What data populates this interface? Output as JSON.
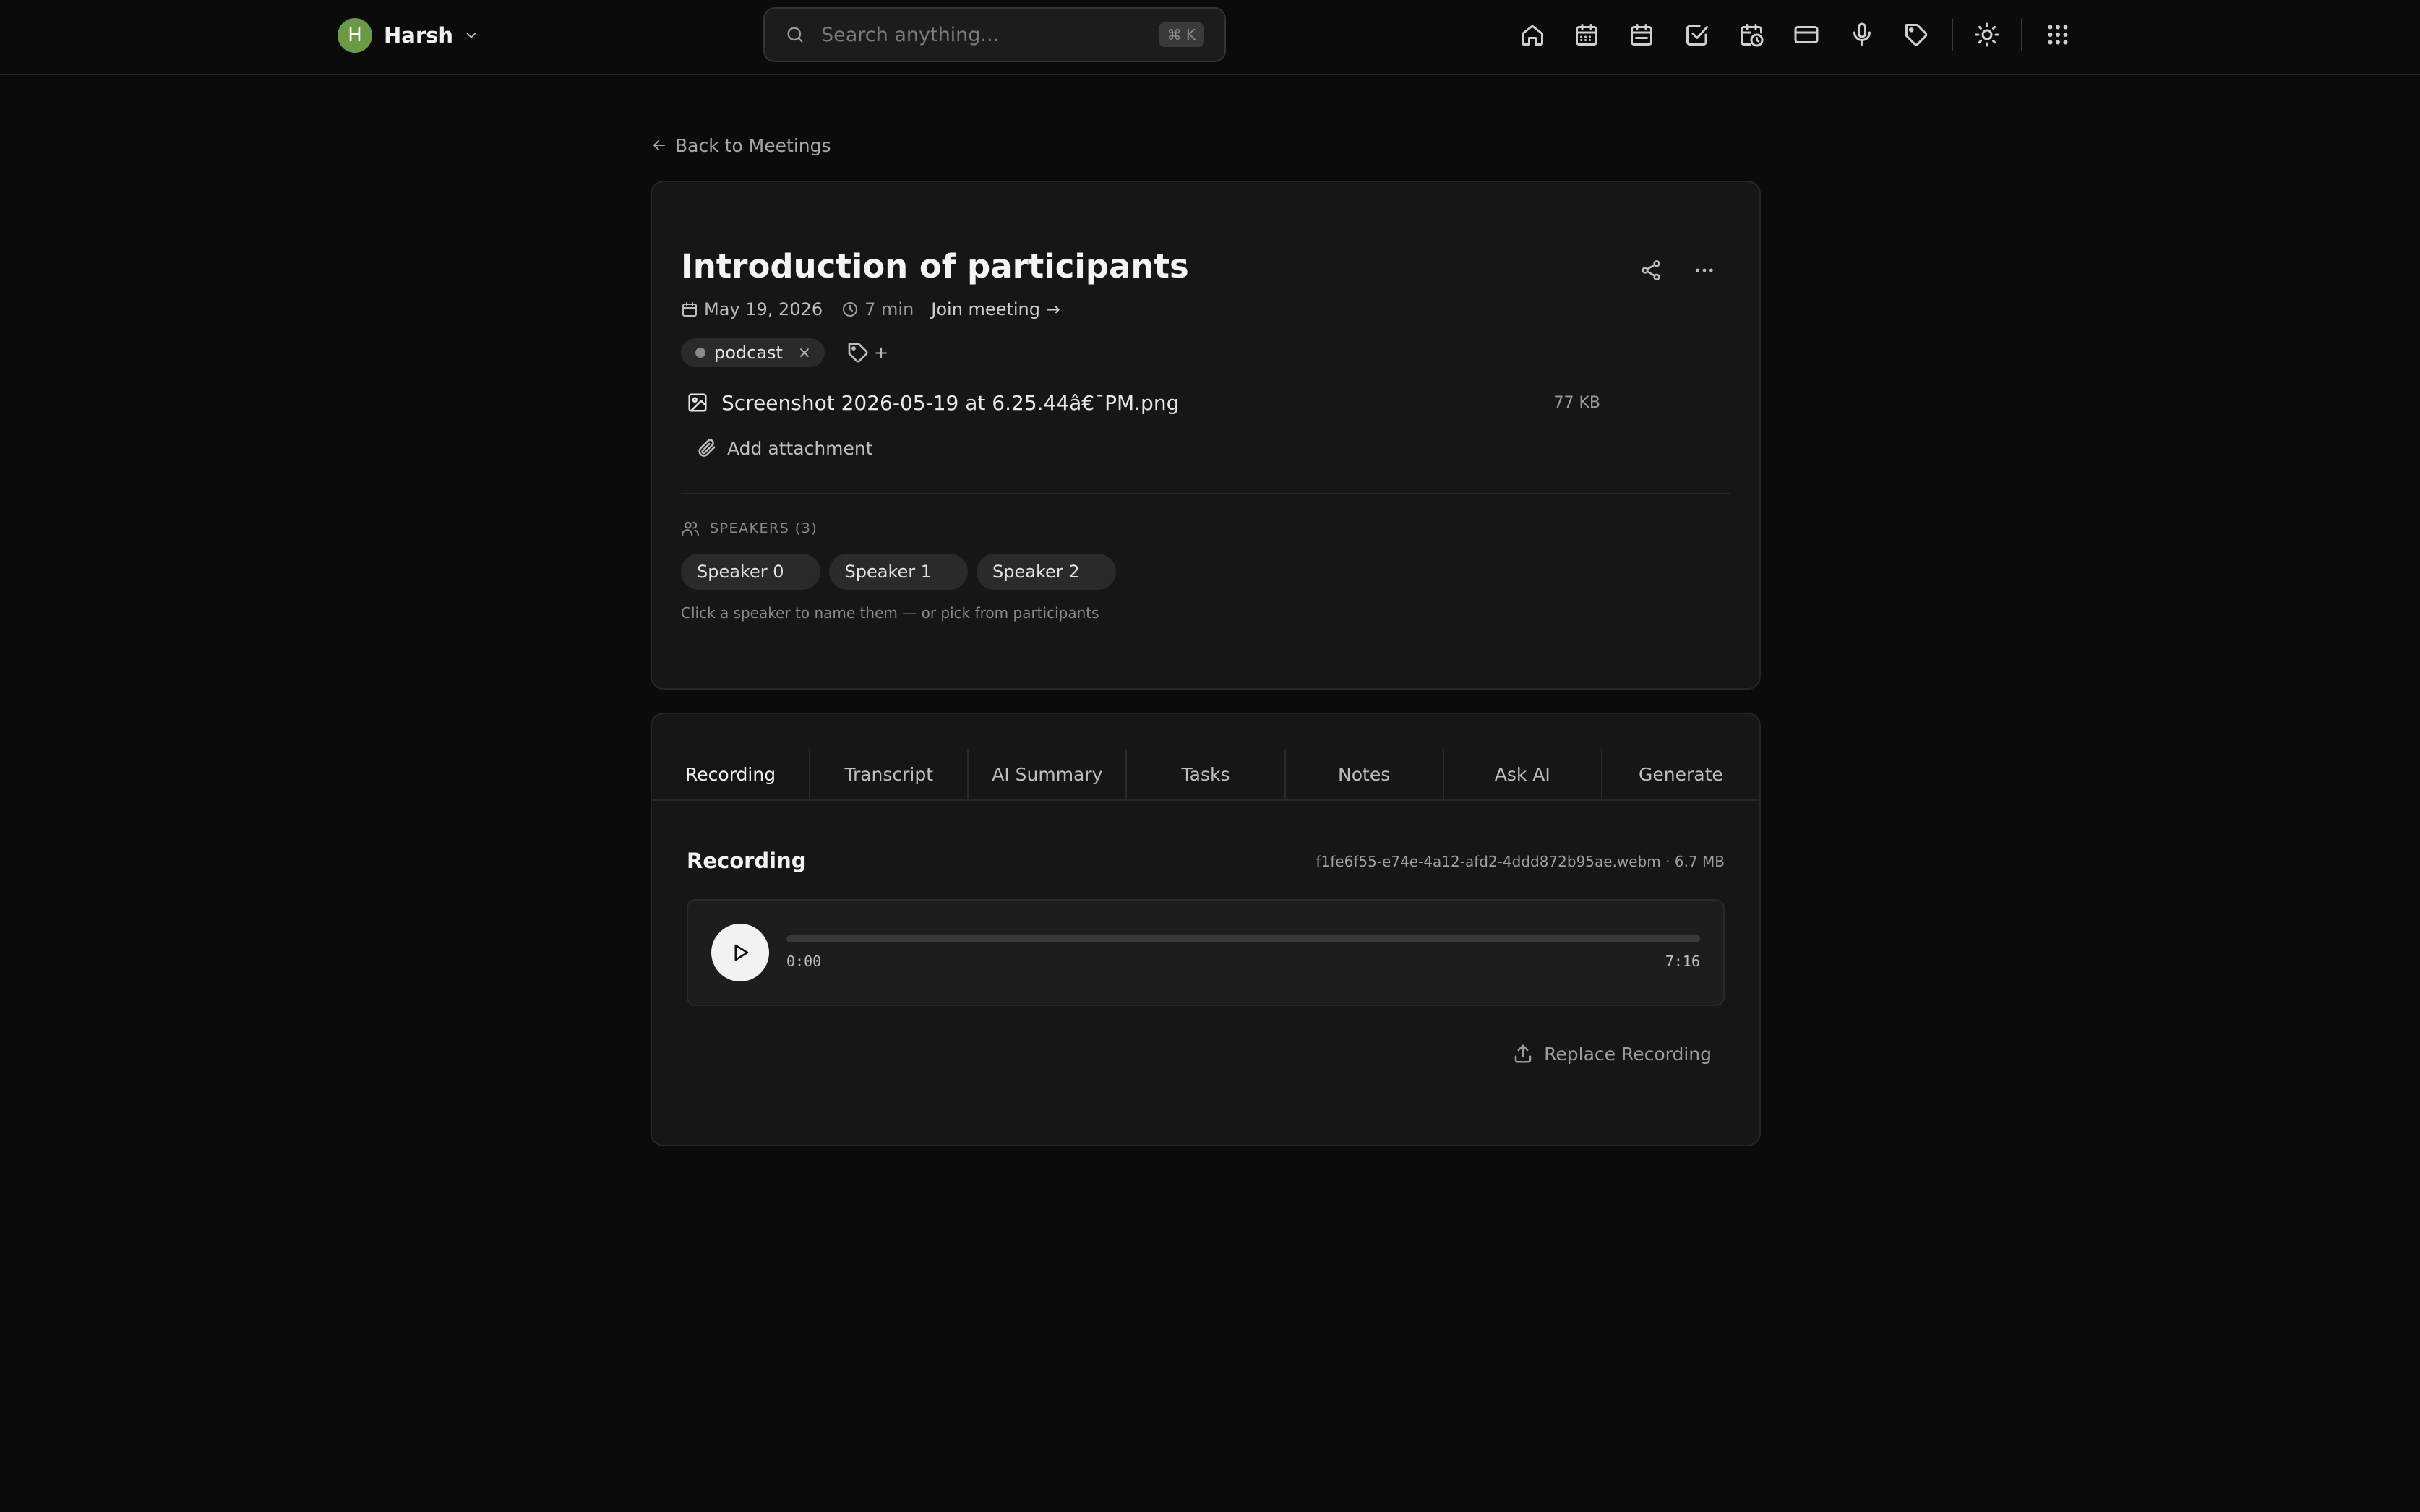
{
  "header": {
    "user": {
      "initial": "H",
      "name": "Harsh"
    },
    "search": {
      "placeholder": "Search anything...",
      "shortcut": "⌘ K"
    },
    "nav_icons": [
      "home-icon",
      "calendar-icon",
      "calendar-days-icon",
      "checkbox-icon",
      "calendar-clock-icon",
      "credit-card-icon",
      "microphone-icon",
      "tag-icon",
      "sun-icon",
      "apps-grid-icon"
    ]
  },
  "back_link": "Back to Meetings",
  "meeting": {
    "title": "Introduction of participants",
    "date": "May 19, 2026",
    "duration": "7 min",
    "join_label": "Join meeting →",
    "tags": [
      {
        "label": "podcast"
      }
    ],
    "tag_add_label": "+",
    "attachments": [
      {
        "name": "Screenshot 2026-05-19 at 6.25.44â€¯PM.png",
        "size": "77 KB"
      }
    ],
    "add_attachment_label": "Add attachment",
    "speakers_heading": "SPEAKERS (3)",
    "speakers": [
      "Speaker 0",
      "Speaker 1",
      "Speaker 2"
    ],
    "speakers_hint": "Click a speaker to name them — or pick from participants"
  },
  "tabs": [
    "Recording",
    "Transcript",
    "AI Summary",
    "Tasks",
    "Notes",
    "Ask AI",
    "Generate"
  ],
  "active_tab": "Recording",
  "recording": {
    "title": "Recording",
    "file_info": "f1fe6f55-e74e-4a12-afd2-4ddd872b95ae.webm · 6.7 MB",
    "current_time": "0:00",
    "total_time": "7:16",
    "progress": 0,
    "replace_label": "Replace Recording"
  },
  "colors": {
    "background": "#0b0b0b",
    "card": "#161616",
    "avatar": "#6b9a47"
  }
}
